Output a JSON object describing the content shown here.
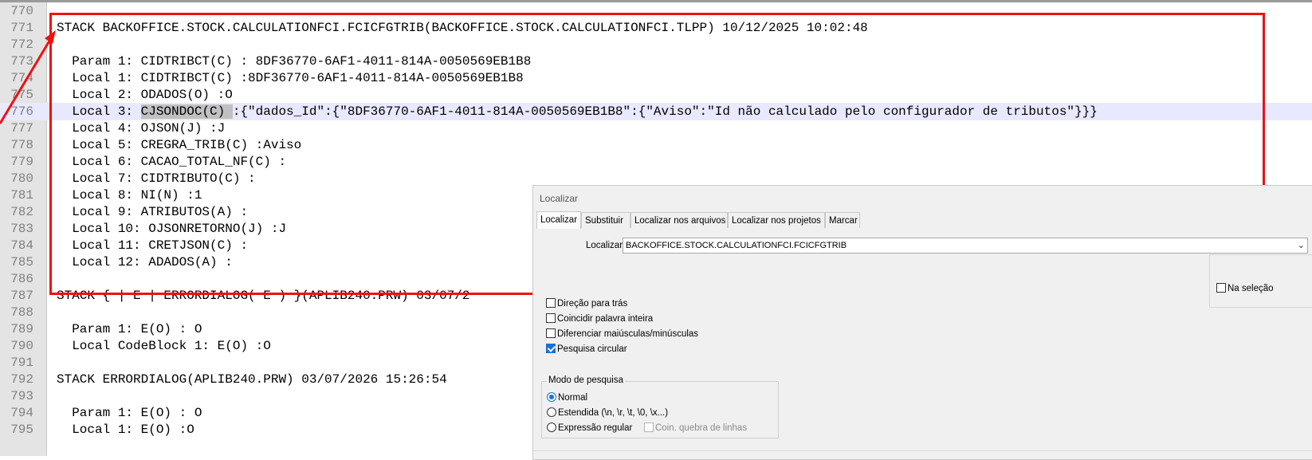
{
  "editor": {
    "lines": [
      {
        "n": "770",
        "text": ""
      },
      {
        "n": "771",
        "text": "STACK BACKOFFICE.STOCK.CALCULATIONFCI.FCICFGTRIB(BACKOFFICE.STOCK.CALCULATIONFCI.TLPP) 10/12/2025 10:02:48"
      },
      {
        "n": "772",
        "text": ""
      },
      {
        "n": "773",
        "text": "  Param 1: CIDTRIBCT(C) : 8DF36770-6AF1-4011-814A-0050569EB1B8"
      },
      {
        "n": "774",
        "text": "  Local 1: CIDTRIBCT(C) :8DF36770-6AF1-4011-814A-0050569EB1B8"
      },
      {
        "n": "775",
        "text": "  Local 2: ODADOS(O) :O"
      },
      {
        "n": "776",
        "pre": "  Local 3: ",
        "hl": "CJSONDOC(C) ",
        "post": ":{\"dados_Id\":{\"8DF36770-6AF1-4011-814A-0050569EB1B8\":{\"Aviso\":\"Id não calculado pelo configurador de tributos\"}}}"
      },
      {
        "n": "777",
        "text": "  Local 4: OJSON(J) :J"
      },
      {
        "n": "778",
        "text": "  Local 5: CREGRA_TRIB(C) :Aviso"
      },
      {
        "n": "779",
        "text": "  Local 6: CACAO_TOTAL_NF(C) :"
      },
      {
        "n": "780",
        "text": "  Local 7: CIDTRIBUTO(C) :"
      },
      {
        "n": "781",
        "text": "  Local 8: NI(N) :1"
      },
      {
        "n": "782",
        "text": "  Local 9: ATRIBUTOS(A) :"
      },
      {
        "n": "783",
        "text": "  Local 10: OJSONRETORNO(J) :J"
      },
      {
        "n": "784",
        "text": "  Local 11: CRETJSON(C) :"
      },
      {
        "n": "785",
        "text": "  Local 12: ADADOS(A) :"
      },
      {
        "n": "786",
        "text": ""
      },
      {
        "n": "787",
        "text": "STACK { | E | ERRORDIALOG( E ) }(APLIB240.PRW) 03/07/2"
      },
      {
        "n": "788",
        "text": ""
      },
      {
        "n": "789",
        "text": "  Param 1: E(O) : O"
      },
      {
        "n": "790",
        "text": "  Local CodeBlock 1: E(O) :O"
      },
      {
        "n": "791",
        "text": ""
      },
      {
        "n": "792",
        "text": "STACK ERRORDIALOG(APLIB240.PRW) 03/07/2026 15:26:54"
      },
      {
        "n": "793",
        "text": ""
      },
      {
        "n": "794",
        "text": "  Param 1: E(O) : O"
      },
      {
        "n": "795",
        "text": "  Local 1: E(O) :O"
      }
    ]
  },
  "dialog": {
    "title": "Localizar",
    "tabs": [
      "Localizar",
      "Substituir",
      "Localizar nos arquivos",
      "Localizar nos projetos",
      "Marcar"
    ],
    "find_label": "Localizar:",
    "find_value": "BACKOFFICE.STOCK.CALCULATIONFCI.FCICFGTRIB",
    "in_selection": "Na seleção",
    "options": [
      {
        "label": "Direção para trás",
        "checked": false
      },
      {
        "label": "Coincidir palavra inteira",
        "checked": false
      },
      {
        "label": "Diferenciar maiúsculas/minúsculas",
        "checked": false
      },
      {
        "label": "Pesquisa circular",
        "checked": true
      }
    ],
    "search_mode": {
      "legend": "Modo de pesquisa",
      "normal": "Normal",
      "extended": "Estendida  (\\n, \\r, \\t, \\0, \\x...)",
      "regex": "Expressão regular",
      "dot_newline": "Coin. quebra de linhas"
    }
  },
  "colors": {
    "annotation": "#ee1111",
    "current_line": "#e8e8ff",
    "check_accent": "#1a6fd8"
  }
}
